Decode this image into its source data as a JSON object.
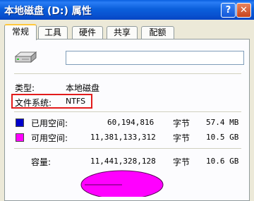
{
  "window": {
    "title": "本地磁盘 (D:) 属性",
    "help_label": "?",
    "close_label": "✕"
  },
  "tabs": [
    {
      "label": "常规",
      "active": true
    },
    {
      "label": "工具",
      "active": false
    },
    {
      "label": "硬件",
      "active": false
    },
    {
      "label": "共享",
      "active": false
    },
    {
      "label": "配额",
      "active": false
    }
  ],
  "general": {
    "volume_label_value": "",
    "type_label": "类型:",
    "type_value": "本地磁盘",
    "fs_label": "文件系统:",
    "fs_value": "NTFS",
    "used": {
      "label": "已用空间:",
      "bytes": "60,194,816",
      "unit": "字节",
      "size": "57.4 MB",
      "color": "#0000cc"
    },
    "free": {
      "label": "可用空间:",
      "bytes": "11,381,133,312",
      "unit": "字节",
      "size": "10.5 GB",
      "color": "#ff00ff"
    },
    "capacity": {
      "label": "容量:",
      "bytes": "11,441,328,128",
      "unit": "字节",
      "size": "10.6 GB"
    }
  },
  "icons": {
    "drive": "hard-drive-icon"
  }
}
